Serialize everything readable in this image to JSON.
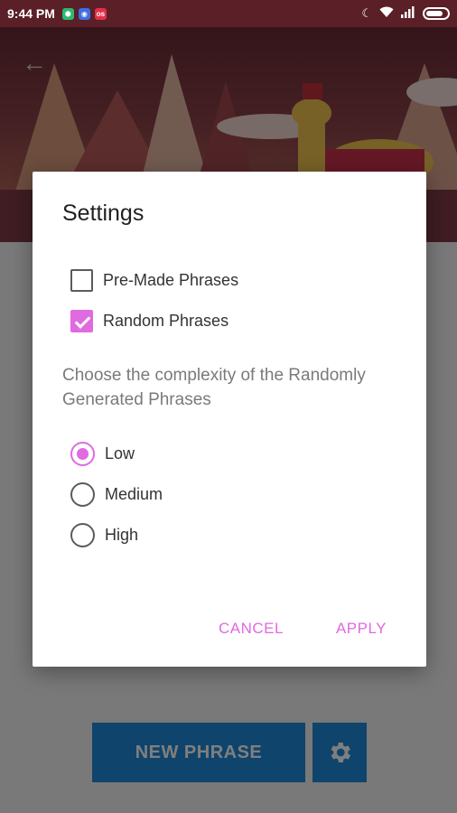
{
  "status_bar": {
    "time": "9:44 PM",
    "notification_icons": [
      "shield-app-icon",
      "browser-app-icon",
      "os-app-icon"
    ],
    "right_icons": [
      "moon-icon",
      "wifi-icon",
      "signal-icon",
      "battery-icon"
    ]
  },
  "dialog": {
    "title": "Settings",
    "checkboxes": [
      {
        "label": "Pre-Made Phrases",
        "checked": false
      },
      {
        "label": "Random Phrases",
        "checked": true
      }
    ],
    "description": "Choose the complexity of the Randomly Generated Phrases",
    "radios": [
      {
        "label": "Low",
        "selected": true
      },
      {
        "label": "Medium",
        "selected": false
      },
      {
        "label": "High",
        "selected": false
      }
    ],
    "cancel_label": "CANCEL",
    "apply_label": "APPLY"
  },
  "bottom": {
    "new_phrase_label": "NEW PHRASE"
  },
  "colors": {
    "accent": "#e06ae0",
    "button_blue": "#1e88d8",
    "status_bar": "#5a1f27"
  }
}
